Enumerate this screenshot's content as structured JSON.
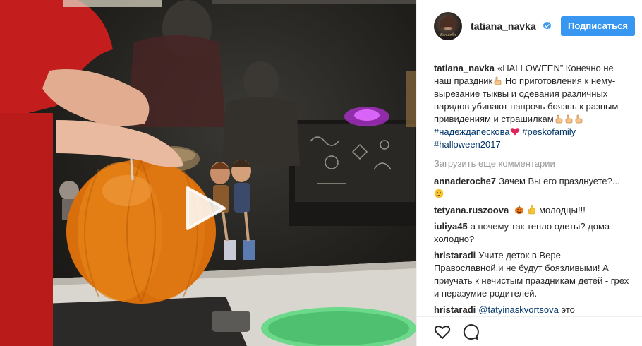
{
  "header": {
    "username": "tatiana_navka",
    "follow_label": "Подписаться"
  },
  "caption": {
    "username": "tatiana_navka",
    "text_1": "«HALLOWEEN” Конечно не наш праздник",
    "text_2": " Но приготовления к нему- вырезание тыквы и одевания различных нарядов убивают напрочь боязнь к разным привидениям и страшилкам",
    "tag_1": "#надеждапескова",
    "tag_2": "#peskofamily",
    "tag_3": "#halloween2017"
  },
  "load_more_label": "Загрузить еще комментарии",
  "comments": [
    {
      "username": "annaderoche7",
      "text": "Зачем Вы его празднуете?..."
    },
    {
      "username": "tetyana.ruszoova",
      "text": "молодцы!!!"
    },
    {
      "username": "iuliya45",
      "text": "а почему так тепло одеты? дома холодно?"
    },
    {
      "username": "hristaradi",
      "text": "Учите деток в Вере Православной,и не будут боязливыми! А приучать к нечистым праздникам детей - грех и неразумие родителей."
    },
    {
      "username": "hristaradi",
      "mention": "@tatyinaskvortsova",
      "text": "это"
    }
  ],
  "icons": {
    "like": "heart-icon",
    "comment": "comment-icon",
    "play": "play-icon",
    "verified": "verified-badge-icon"
  },
  "colors": {
    "follow_button": "#3897f0",
    "hashtag": "#003569",
    "muted": "#999999",
    "border": "#efefef",
    "pumpkin": "#e07a12"
  }
}
